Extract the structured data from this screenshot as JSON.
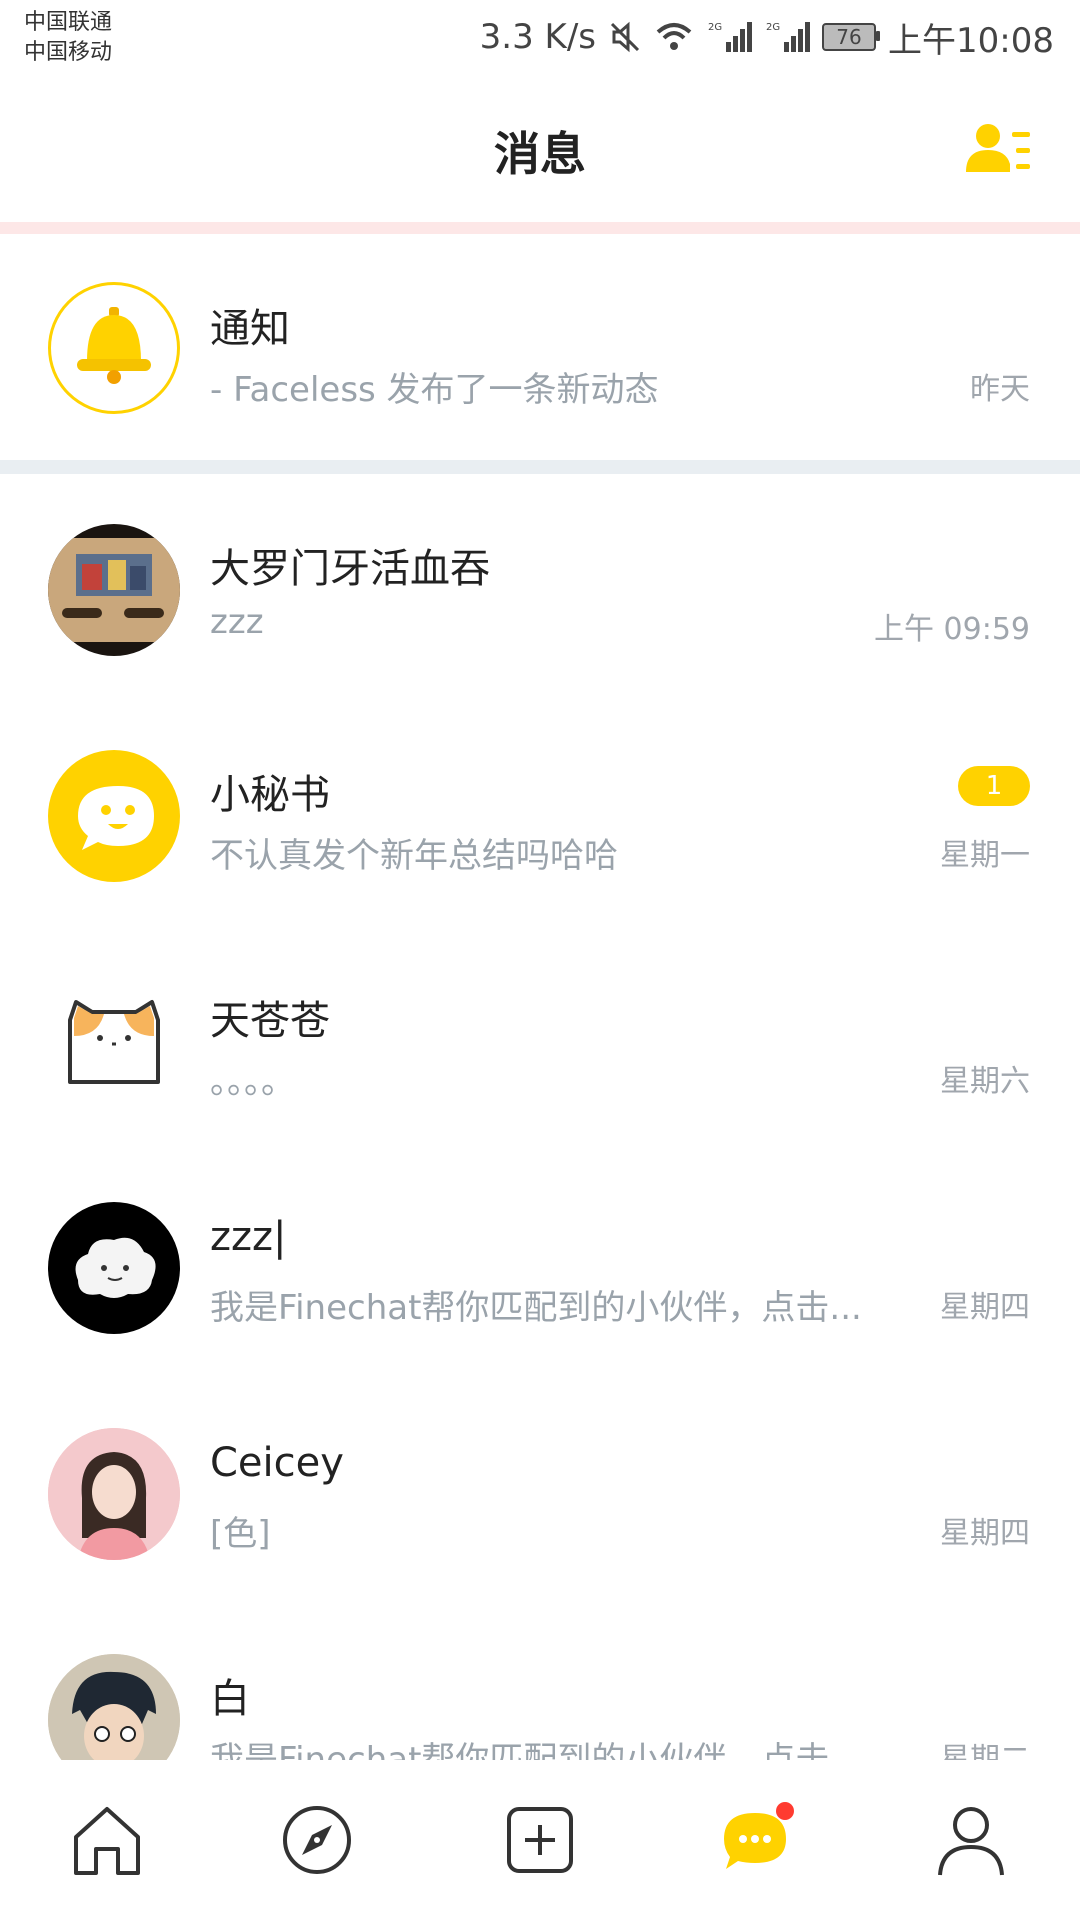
{
  "status_bar": {
    "carrier_1": "中国联通",
    "carrier_2": "中国移动",
    "speed": "3.3 K/s",
    "signal_1_label": "2G",
    "signal_2_label": "2G",
    "battery": "76",
    "time": "上午10:08"
  },
  "header": {
    "title": "消息",
    "accent_color": "#FFD200"
  },
  "notice": {
    "title": "通知",
    "preview": "- Faceless 发布了一条新动态",
    "time": "昨天"
  },
  "conversations": [
    {
      "name": "大罗门牙活血吞",
      "preview": "zzz",
      "time": "上午 09:59",
      "avatar": "game-poster-avatar"
    },
    {
      "name": "小秘书",
      "preview": "不认真发个新年总结吗哈哈",
      "time": "星期一",
      "badge": "1",
      "avatar": "chat-bubble-avatar"
    },
    {
      "name": "天苍苍",
      "preview": "。。。。",
      "time": "星期六",
      "avatar": "cat-avatar"
    },
    {
      "name": "zzz|",
      "preview": "我是Finechat帮你匹配到的小伙伴，点击...",
      "time": "星期四",
      "avatar": "cloud-avatar"
    },
    {
      "name": "Ceicey",
      "preview": "[色]",
      "time": "星期四",
      "avatar": "girl-avatar"
    },
    {
      "name": "白",
      "preview": "我是Finechat帮你匹配到的小伙伴，点击...",
      "time": "星期二",
      "avatar": "boy-avatar"
    }
  ],
  "tabbar": {
    "items": [
      "home-icon",
      "compass-icon",
      "add-icon",
      "message-icon",
      "profile-icon"
    ],
    "active": "message-icon"
  }
}
